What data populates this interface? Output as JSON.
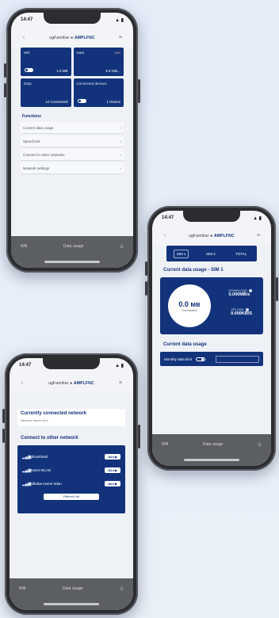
{
  "status": {
    "time": "14:47",
    "signal": "▲ ▮"
  },
  "brand": {
    "prefix": "ugFamiliar ● ",
    "name": "AMPLFNC"
  },
  "nav": {
    "left": "Wifi",
    "center": "Data usage",
    "right": "Ⓢ"
  },
  "phone1": {
    "tiles": [
      {
        "title": "Wifi",
        "value": "1.0 MB",
        "right": ""
      },
      {
        "title": "Data",
        "value": "3.0 GB/...",
        "right": "10%"
      },
      {
        "title": "Data",
        "value": "10 Connected",
        "right": ""
      },
      {
        "title": "Connected devices",
        "value": "1 Device",
        "right": ""
      }
    ],
    "functions_title": "Functions",
    "functions": [
      "Current data usage",
      "Speed test",
      "Connect to other networks",
      "Network settings"
    ]
  },
  "phone2": {
    "tabs": [
      "SIM 1",
      "SIM 2",
      "TOTAL"
    ],
    "usage_title": "Current data usage - SIM 1",
    "circle_value": "0.0 мв",
    "circle_label": "Connected",
    "download_label": "DOWNLOAD",
    "download_value": "0.000MB/s",
    "upload_label": "UPLOAD",
    "upload_value": "0.000KB/S",
    "current_title": "Current data usage",
    "bar_label": "Monthly data limit"
  },
  "phone3": {
    "current_title": "Currently connected network",
    "current_sub": "Network name here",
    "other_title": "Connect to other network",
    "networks": [
      {
        "name": "UltraShield",
        "action": "Join ▶"
      },
      {
        "name": "Guest WLAN",
        "action": "Join ▶"
      },
      {
        "name": "Alibaba Home Wlan",
        "action": "Join ▶"
      }
    ],
    "refresh": "Refresh list"
  }
}
